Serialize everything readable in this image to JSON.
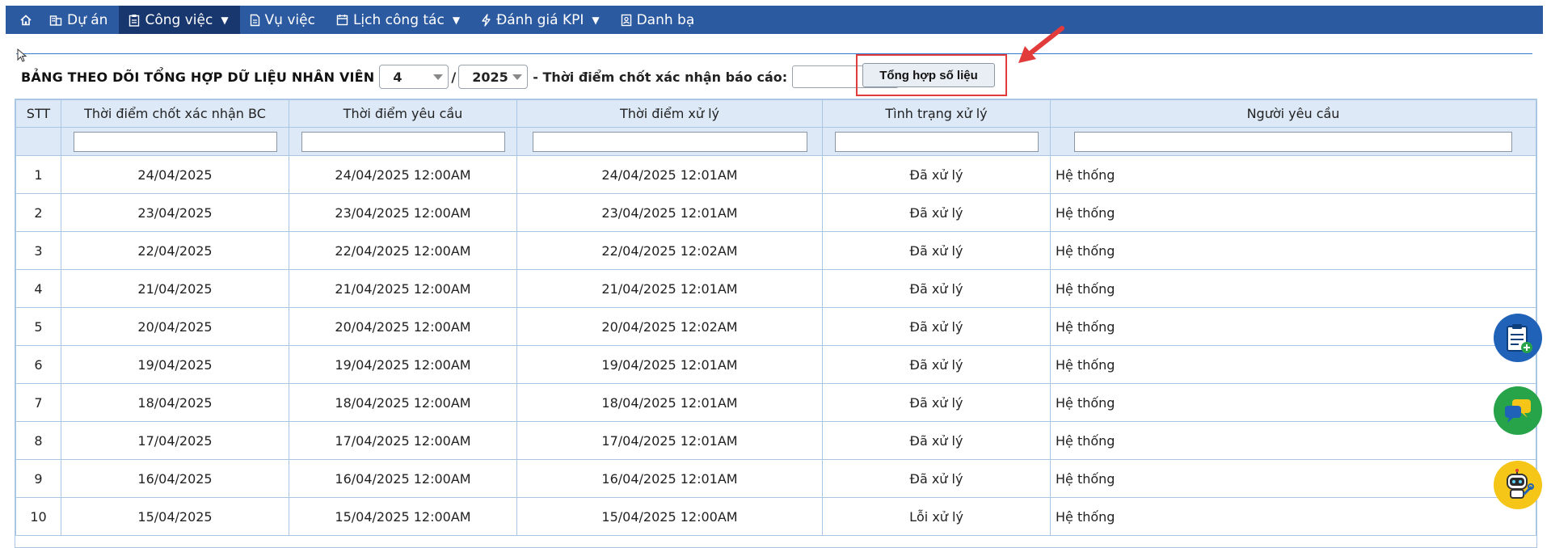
{
  "nav": {
    "home_icon": "home-icon",
    "items": [
      {
        "label": "Dự án",
        "icon": "building-icon",
        "dropdown": false
      },
      {
        "label": "Công việc",
        "icon": "clipboard-icon",
        "dropdown": true,
        "active": true
      },
      {
        "label": "Vụ việc",
        "icon": "document-icon",
        "dropdown": false
      },
      {
        "label": "Lịch công tác",
        "icon": "calendar-icon",
        "dropdown": true
      },
      {
        "label": "Đánh giá KPI",
        "icon": "bolt-icon",
        "dropdown": true
      },
      {
        "label": "Danh bạ",
        "icon": "contact-book-icon",
        "dropdown": false
      }
    ]
  },
  "filter": {
    "title": "BẢNG THEO DÕI TỔNG HỢP DỮ LIỆU NHÂN VIÊN",
    "month": "4",
    "separator": "/",
    "year": "2025",
    "chot_label": "- Thời điểm chốt xác nhận báo cáo:",
    "chot_value": "",
    "submit_label": "Tổng hợp số liệu"
  },
  "table": {
    "columns": [
      "STT",
      "Thời điểm chốt xác nhận BC",
      "Thời điểm yêu cầu",
      "Thời điểm xử lý",
      "Tình trạng xử lý",
      "Người yêu cầu"
    ],
    "rows": [
      [
        "1",
        "24/04/2025",
        "24/04/2025 12:00AM",
        "24/04/2025 12:01AM",
        "Đã xử lý",
        "Hệ thống"
      ],
      [
        "2",
        "23/04/2025",
        "23/04/2025 12:00AM",
        "23/04/2025 12:01AM",
        "Đã xử lý",
        "Hệ thống"
      ],
      [
        "3",
        "22/04/2025",
        "22/04/2025 12:00AM",
        "22/04/2025 12:02AM",
        "Đã xử lý",
        "Hệ thống"
      ],
      [
        "4",
        "21/04/2025",
        "21/04/2025 12:00AM",
        "21/04/2025 12:01AM",
        "Đã xử lý",
        "Hệ thống"
      ],
      [
        "5",
        "20/04/2025",
        "20/04/2025 12:00AM",
        "20/04/2025 12:02AM",
        "Đã xử lý",
        "Hệ thống"
      ],
      [
        "6",
        "19/04/2025",
        "19/04/2025 12:00AM",
        "19/04/2025 12:01AM",
        "Đã xử lý",
        "Hệ thống"
      ],
      [
        "7",
        "18/04/2025",
        "18/04/2025 12:00AM",
        "18/04/2025 12:01AM",
        "Đã xử lý",
        "Hệ thống"
      ],
      [
        "8",
        "17/04/2025",
        "17/04/2025 12:00AM",
        "17/04/2025 12:01AM",
        "Đã xử lý",
        "Hệ thống"
      ],
      [
        "9",
        "16/04/2025",
        "16/04/2025 12:00AM",
        "16/04/2025 12:01AM",
        "Đã xử lý",
        "Hệ thống"
      ],
      [
        "10",
        "15/04/2025",
        "15/04/2025 12:00AM",
        "15/04/2025 12:00AM",
        "Lỗi xử lý",
        "Hệ thống"
      ]
    ]
  },
  "floating": [
    {
      "icon": "add-report-icon",
      "color": "#1f62b8"
    },
    {
      "icon": "chat-icon",
      "color": "#27a34a"
    },
    {
      "icon": "robot-support-icon",
      "color": "#f5c518"
    }
  ],
  "colors": {
    "nav_bg": "#2c5aa0",
    "nav_active": "#17376e",
    "table_header": "#dde9f7",
    "border": "#a9c6e4",
    "highlight": "#e23b3b"
  }
}
